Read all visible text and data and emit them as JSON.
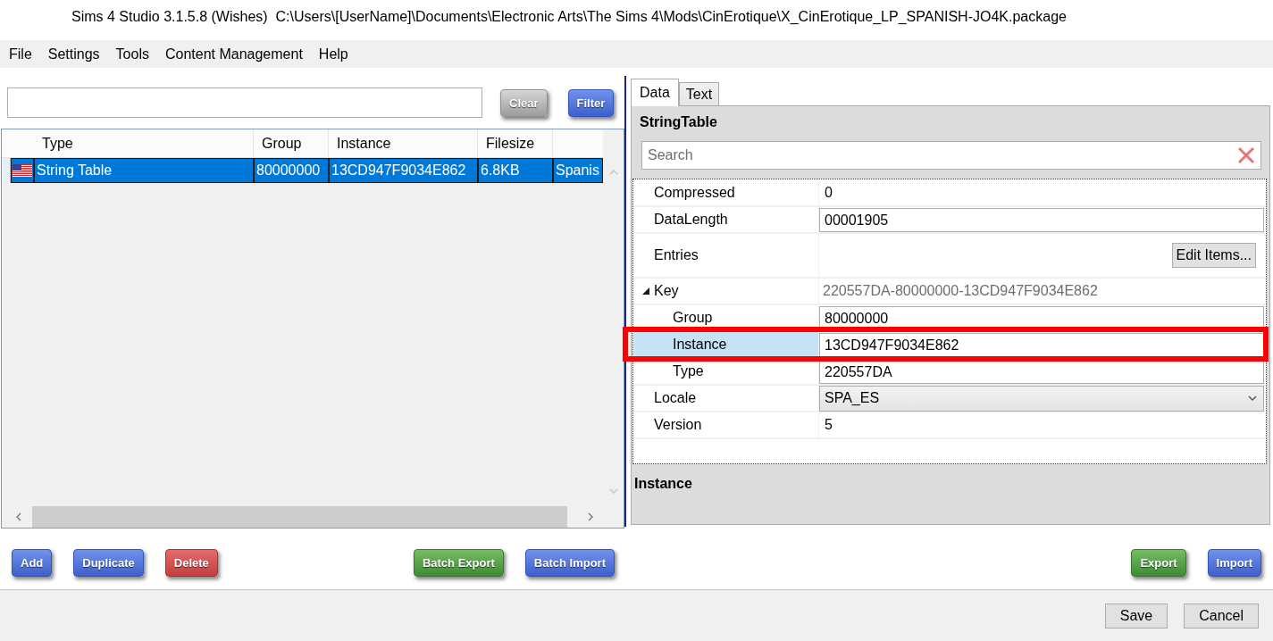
{
  "window": {
    "title": "Sims 4 Studio 3.1.5.8 (Wishes)  C:\\Users\\[UserName]\\Documents\\Electronic Arts\\The Sims 4\\Mods\\CinErotique\\X_CinErotique_LP_SPANISH-JO4K.package"
  },
  "menu": [
    {
      "label": "File"
    },
    {
      "label": "Settings"
    },
    {
      "label": "Tools"
    },
    {
      "label": "Content Management"
    },
    {
      "label": "Help"
    }
  ],
  "filter_buttons": [
    {
      "label": "Clear",
      "kind": "neutral"
    },
    {
      "label": "Filter",
      "kind": "primary"
    }
  ],
  "table": {
    "columns": [
      {
        "label": "Type"
      },
      {
        "label": "Group"
      },
      {
        "label": "Instance"
      },
      {
        "label": "Filesize"
      }
    ],
    "rows": [
      {
        "selected": true,
        "cells": [
          "String Table",
          "80000000",
          "13CD947F9034E862",
          "6.8KB",
          "Spanis"
        ]
      }
    ]
  },
  "list_actions": {
    "start": [
      {
        "label": "Add",
        "kind": "primary"
      },
      {
        "label": "Duplicate",
        "kind": "primary"
      },
      {
        "label": "Delete",
        "kind": "danger"
      }
    ],
    "end": [
      {
        "label": "Batch Export",
        "kind": "success"
      },
      {
        "label": "Batch Import",
        "kind": "primary"
      }
    ]
  },
  "tabs": [
    {
      "label": "Data",
      "selected": true
    },
    {
      "label": "Text",
      "selected": false
    }
  ],
  "editor": {
    "title": "StringTable",
    "search": {
      "placeholder": "Search"
    },
    "properties": [
      {
        "label": "Compressed",
        "kind": "text",
        "value": "0",
        "selected": false,
        "highlighted": false
      },
      {
        "label": "DataLength",
        "kind": "field",
        "value": "00001905",
        "selected": false,
        "highlighted": false
      },
      {
        "label": "Entries",
        "kind": "button",
        "value": "Edit Items...",
        "selected": false,
        "highlighted": false
      },
      {
        "label": "Key",
        "kind": "group",
        "value": "220557DA-80000000-13CD947F9034E862",
        "expanded": true,
        "selected": false,
        "highlighted": false,
        "children": [
          {
            "label": "Group",
            "kind": "field",
            "value": "80000000",
            "selected": false,
            "highlighted": false
          },
          {
            "label": "Instance",
            "kind": "field",
            "value": "13CD947F9034E862",
            "selected": true,
            "highlighted": true
          },
          {
            "label": "Type",
            "kind": "field",
            "value": "220557DA",
            "selected": false,
            "highlighted": false
          }
        ]
      },
      {
        "label": "Locale",
        "kind": "dropdown",
        "value": "SPA_ES",
        "selected": false,
        "highlighted": false
      },
      {
        "label": "Version",
        "kind": "text",
        "value": "5",
        "selected": false,
        "highlighted": false
      }
    ],
    "description": {
      "title": "Instance"
    }
  },
  "panel_actions": [
    {
      "label": "Export",
      "kind": "success"
    },
    {
      "label": "Import",
      "kind": "primary"
    }
  ],
  "dialog_buttons": [
    {
      "label": "Save"
    },
    {
      "label": "Cancel"
    }
  ]
}
